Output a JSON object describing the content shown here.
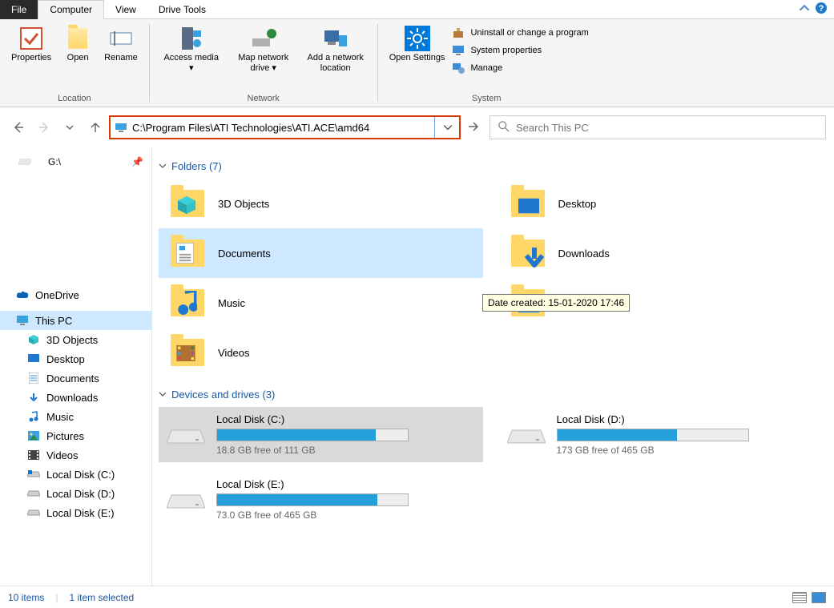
{
  "tabs": {
    "file": "File",
    "computer": "Computer",
    "view": "View",
    "drive_tools": "Drive Tools"
  },
  "ribbon": {
    "location": {
      "title": "Location",
      "properties": "Properties",
      "open": "Open",
      "rename": "Rename"
    },
    "network": {
      "title": "Network",
      "access_media": "Access media",
      "map_drive": "Map network drive",
      "add_location": "Add a network location"
    },
    "system": {
      "title": "System",
      "open_settings": "Open Settings",
      "uninstall": "Uninstall or change a program",
      "sys_props": "System properties",
      "manage": "Manage"
    }
  },
  "address": {
    "path": "C:\\Program Files\\ATI Technologies\\ATI.ACE\\amd64"
  },
  "search": {
    "placeholder": "Search This PC"
  },
  "sidebar": {
    "quick": "G:\\",
    "onedrive": "OneDrive",
    "thispc": "This PC",
    "items": [
      "3D Objects",
      "Desktop",
      "Documents",
      "Downloads",
      "Music",
      "Pictures",
      "Videos",
      "Local Disk (C:)",
      "Local Disk (D:)",
      "Local Disk (E:)"
    ]
  },
  "sections": {
    "folders_header": "Folders (7)",
    "drives_header": "Devices and drives (3)"
  },
  "folders": [
    {
      "name": "3D Objects"
    },
    {
      "name": "Desktop"
    },
    {
      "name": "Documents",
      "selected": true
    },
    {
      "name": "Downloads"
    },
    {
      "name": "Music"
    },
    {
      "name": "Pictures"
    },
    {
      "name": "Videos"
    }
  ],
  "tooltip": "Date created: 15-01-2020 17:46",
  "drives": [
    {
      "name": "Local Disk (C:)",
      "free": "18.8 GB free of 111 GB",
      "fill": 83,
      "selected": true,
      "os": true
    },
    {
      "name": "Local Disk (D:)",
      "free": "173 GB free of 465 GB",
      "fill": 63
    },
    {
      "name": "Local Disk (E:)",
      "free": "73.0 GB free of 465 GB",
      "fill": 84
    }
  ],
  "status": {
    "items": "10 items",
    "selected": "1 item selected"
  }
}
